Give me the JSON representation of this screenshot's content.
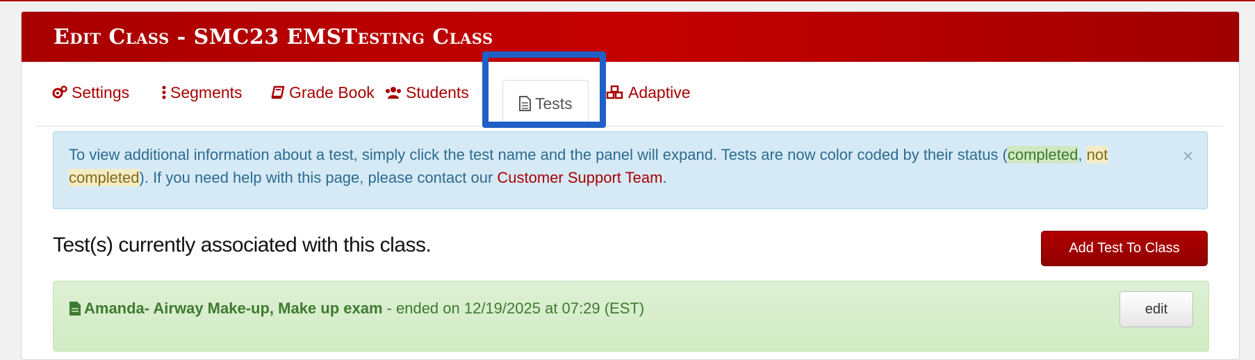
{
  "page": {
    "title": "Edit Class - SMC23 EMSTesting Class"
  },
  "tabs": [
    {
      "label": "Settings",
      "icon": "gears-icon"
    },
    {
      "label": "Segments",
      "icon": "vertical-dots-icon"
    },
    {
      "label": "Grade Book",
      "icon": "book-icon"
    },
    {
      "label": "Students",
      "icon": "users-icon"
    },
    {
      "label": "Tests",
      "icon": "file-text-icon",
      "active": true
    },
    {
      "label": "Adaptive",
      "icon": "cubes-icon"
    }
  ],
  "alert": {
    "text_before": "To view additional information about a test, simply click the test name and the panel will expand. Tests are now color coded by their status (",
    "completed": "completed",
    "separator": ", ",
    "not_completed": "not completed",
    "text_middle": "). If you need help with this page, please contact our ",
    "link": "Customer Support Team",
    "text_after": ".",
    "close": "×"
  },
  "section": {
    "title": "Test(s) currently associated with this class.",
    "add_button": "Add Test To Class"
  },
  "tests": [
    {
      "name": "Amanda- Airway Make-up, Make up exam",
      "meta": "- ended on 12/19/2025 at 07:29 (EST)",
      "edit_label": "edit"
    }
  ],
  "colors": {
    "brand": "#b30000",
    "highlight": "#1f5fc6",
    "completed_bg": "#d2ebc4",
    "info_bg": "#d6eaf6"
  }
}
